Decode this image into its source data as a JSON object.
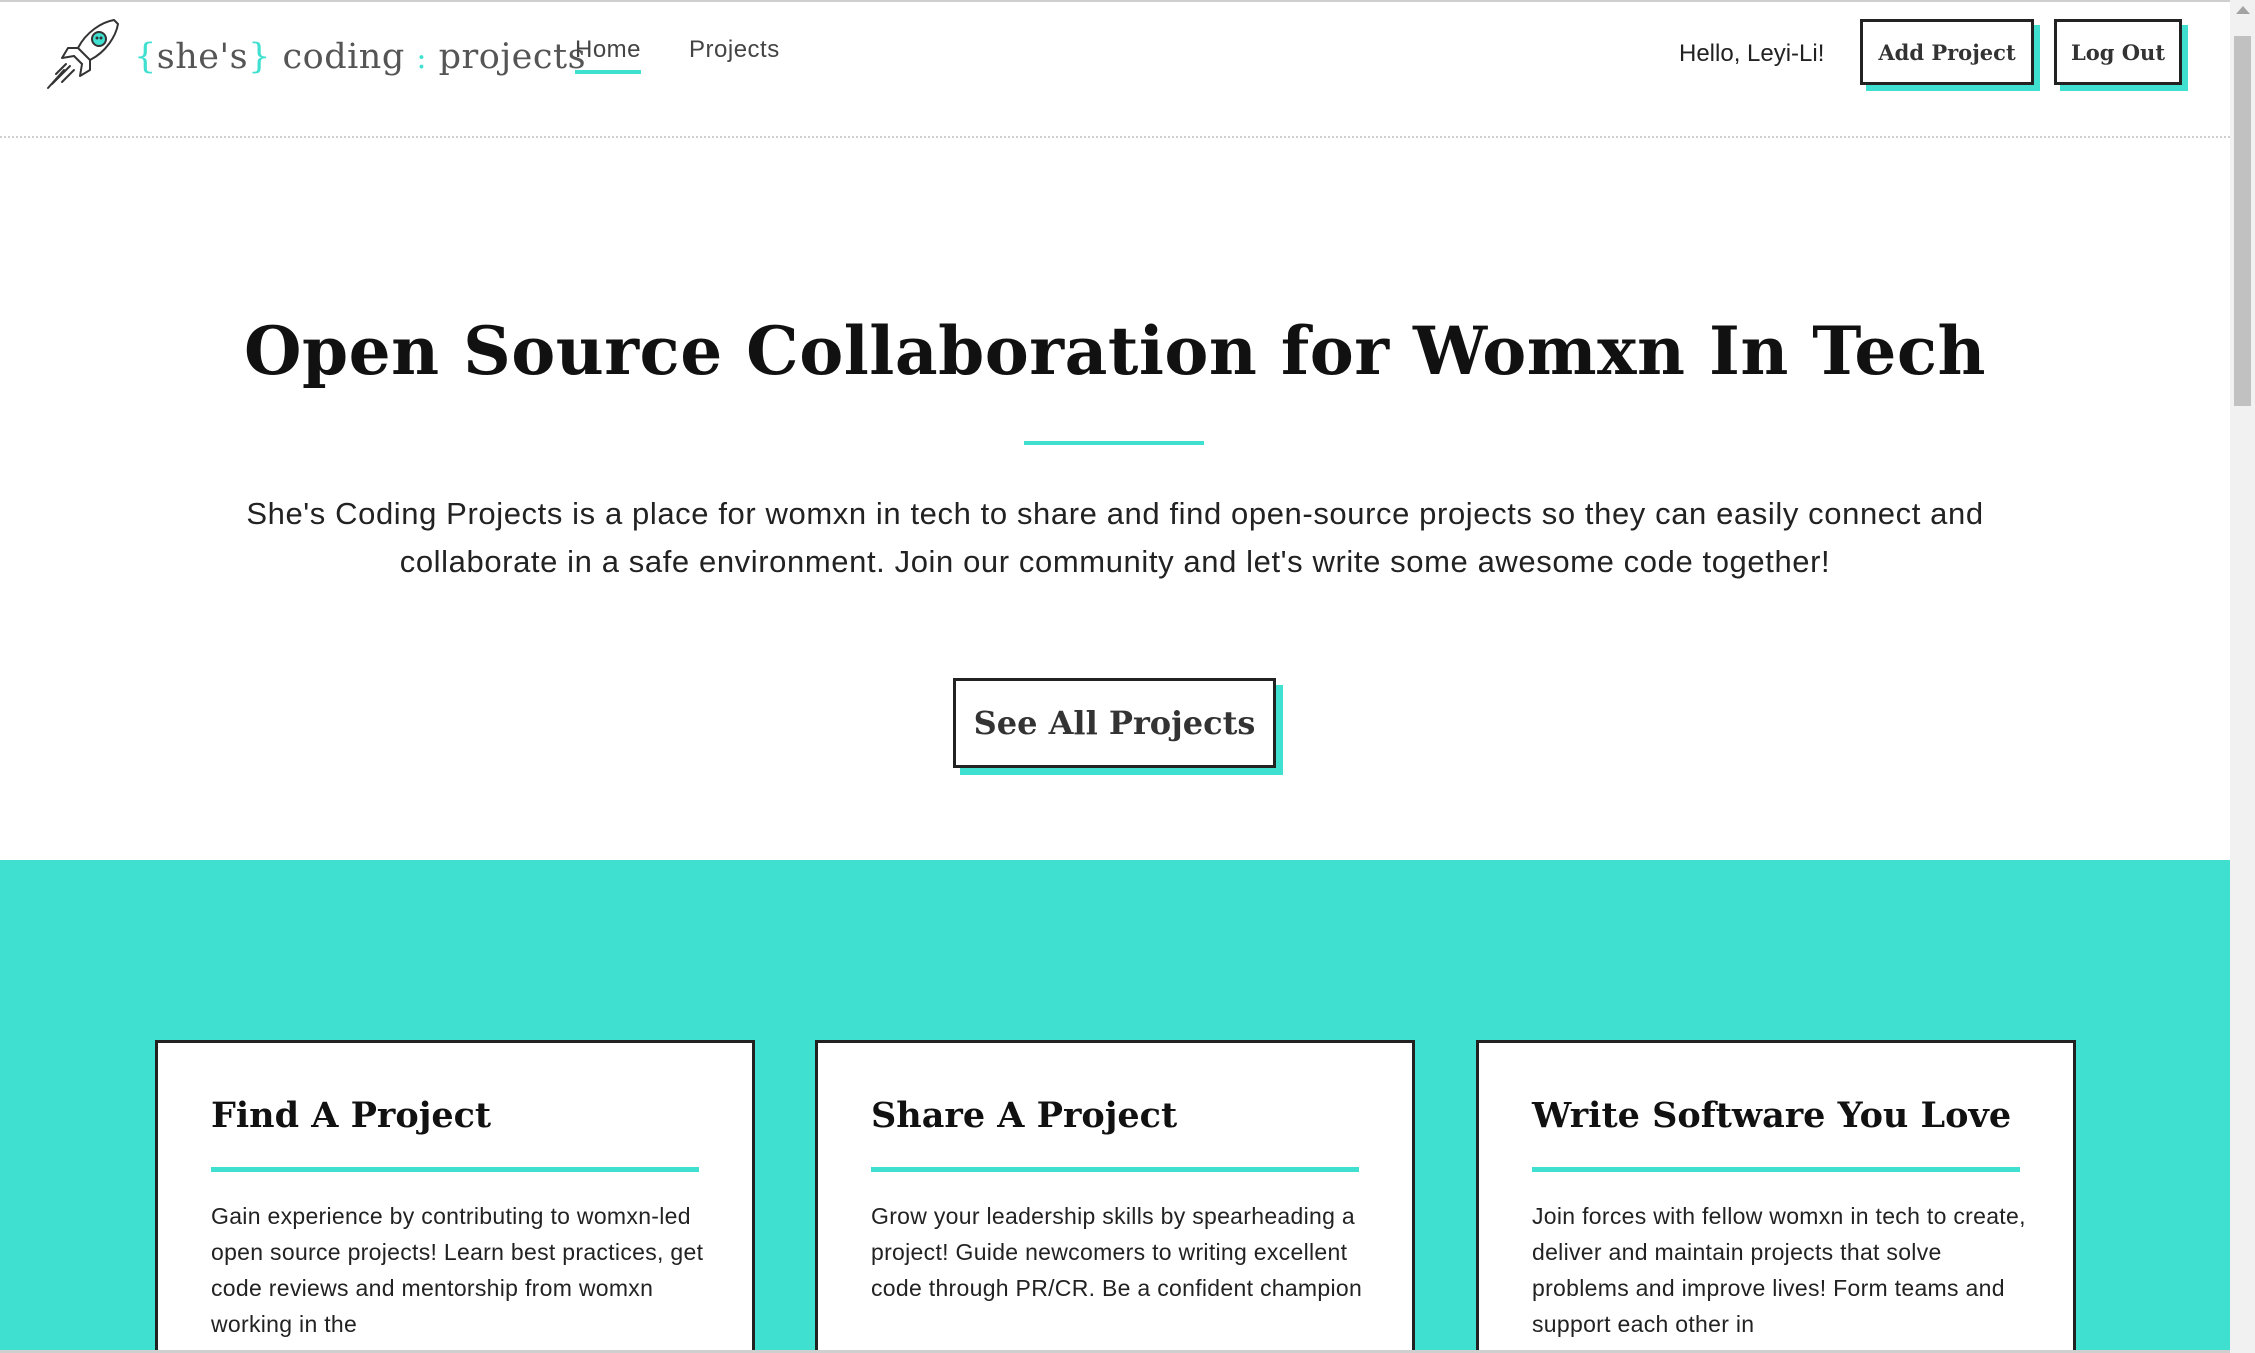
{
  "brand": {
    "open_brace": "{",
    "shes": "she's",
    "close_brace": "}",
    "coding": "coding",
    "colon": ":",
    "projects": "projects"
  },
  "nav": {
    "items": [
      {
        "label": "Home",
        "active": true
      },
      {
        "label": "Projects",
        "active": false
      }
    ]
  },
  "user": {
    "greeting": "Hello, Leyi-Li!"
  },
  "header_buttons": {
    "add_project": "Add Project",
    "log_out": "Log Out"
  },
  "hero": {
    "title": "Open Source Collaboration for Womxn In Tech",
    "description": "She's Coding Projects is a place for womxn in tech to share and find open-source projects so they can easily connect and collaborate in a safe environment. Join our community and let's write some awesome code together!",
    "cta": "See All Projects"
  },
  "cards": [
    {
      "title": "Find A Project",
      "body": "Gain experience by contributing to womxn-led open source projects! Learn best practices, get code reviews and mentorship from womxn working in the"
    },
    {
      "title": "Share A Project",
      "body": "Grow your leadership skills by spearheading a project! Guide newcomers to writing excellent code through PR/CR. Be a confident champion"
    },
    {
      "title": "Write Software You Love",
      "body": "Join forces with fellow womxn in tech to create, deliver and maintain projects that solve problems and improve lives! Form teams and support each other in"
    }
  ],
  "colors": {
    "accent": "#40e0d0",
    "text": "#1a1a1a",
    "border": "#222222"
  }
}
